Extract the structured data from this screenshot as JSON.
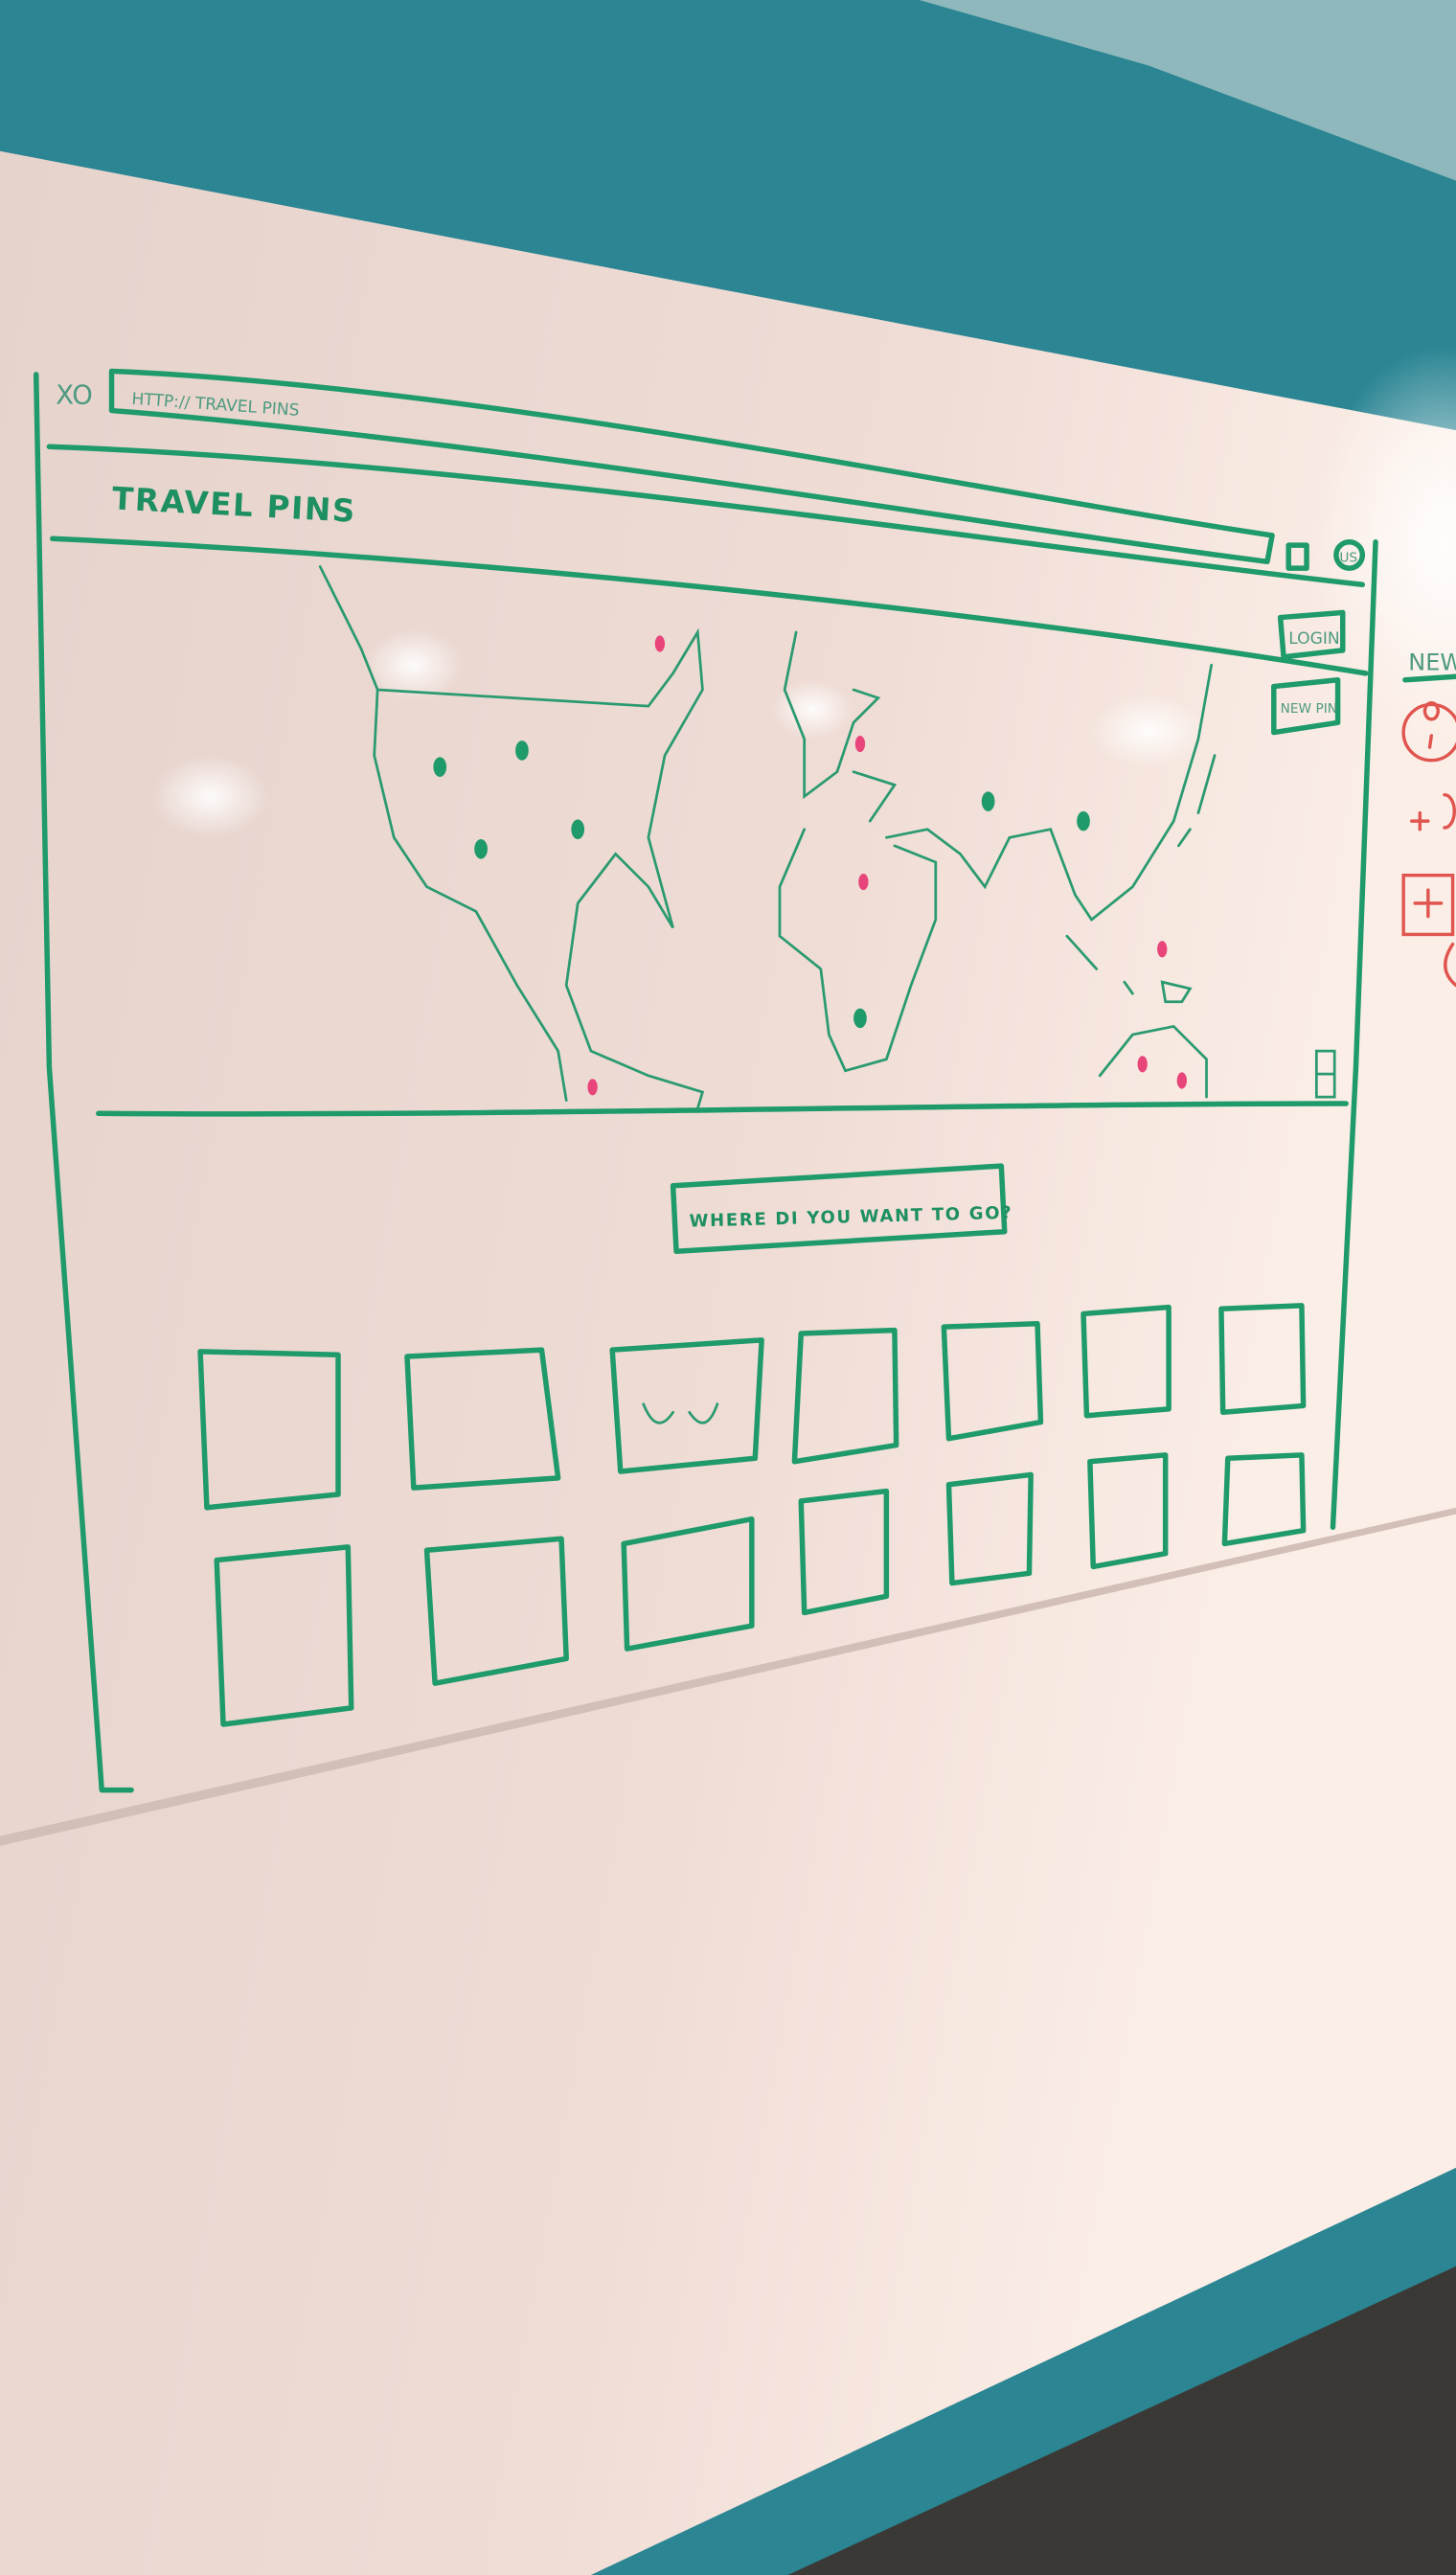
{
  "browser": {
    "window_controls": "XO",
    "address_bar": "HTTP:// TRAVEL PINS"
  },
  "header": {
    "title": "TRAVEL PINS",
    "avatar_initials": "US"
  },
  "map": {
    "login_button": "LOGIN",
    "new_pin_button": "NEW PIN"
  },
  "search": {
    "placeholder": "WHERE DI YOU WANT TO GO?"
  },
  "side_note": {
    "heading": "NEW"
  },
  "colors": {
    "marker_green": "#1f9a6a",
    "marker_pink": "#e8457a",
    "marker_red": "#e0554f",
    "wall": "#2a7f8c",
    "whiteboard": "#efdcd4"
  }
}
